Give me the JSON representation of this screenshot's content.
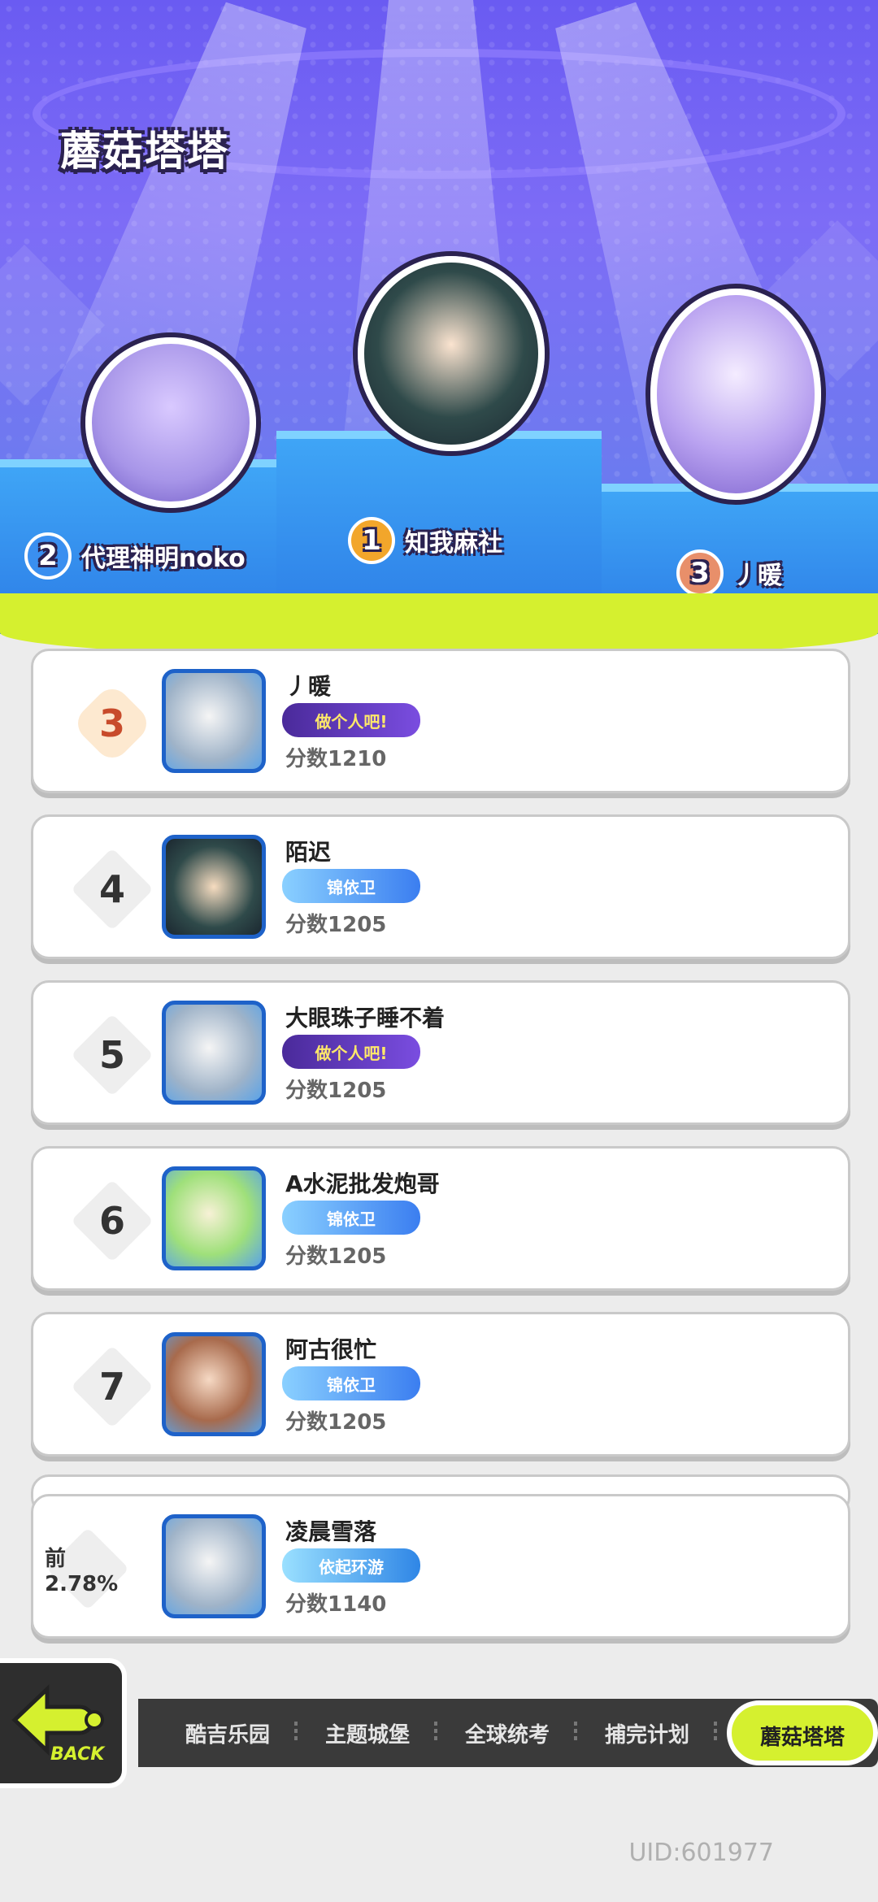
{
  "title": "蘑菇塔塔",
  "podium": [
    {
      "rank": "2",
      "name": "代理神明noko",
      "badge_color": "#3a8ff0"
    },
    {
      "rank": "1",
      "name": "知我麻社",
      "badge_color": "#f2a62b"
    },
    {
      "rank": "3",
      "name": "丿暖",
      "badge_color": "#e88f6a"
    }
  ],
  "leaderboard": [
    {
      "rank": "3",
      "name": "丿暖",
      "tag": "做个人吧!",
      "score_label": "分数",
      "score": "1210"
    },
    {
      "rank": "4",
      "name": "陌迟",
      "tag": "锦依卫",
      "score_label": "分数",
      "score": "1205"
    },
    {
      "rank": "5",
      "name": "大眼珠子睡不着",
      "tag": "做个人吧!",
      "score_label": "分数",
      "score": "1205"
    },
    {
      "rank": "6",
      "name": "A水泥批发炮哥",
      "tag": "锦依卫",
      "score_label": "分数",
      "score": "1205"
    },
    {
      "rank": "7",
      "name": "阿古很忙",
      "tag": "锦依卫",
      "score_label": "分数",
      "score": "1205"
    }
  ],
  "my_entry": {
    "rank": "前2.78%",
    "name": "凌晨雪落",
    "tag": "依起环游",
    "score_label": "分数",
    "score": "1140"
  },
  "tabs": [
    "酷吉乐园",
    "主题城堡",
    "全球统考",
    "捕完计划",
    "蘑菇塔塔"
  ],
  "active_tab": "蘑菇塔塔",
  "back_label": "BACK",
  "uid": "UID:601977"
}
